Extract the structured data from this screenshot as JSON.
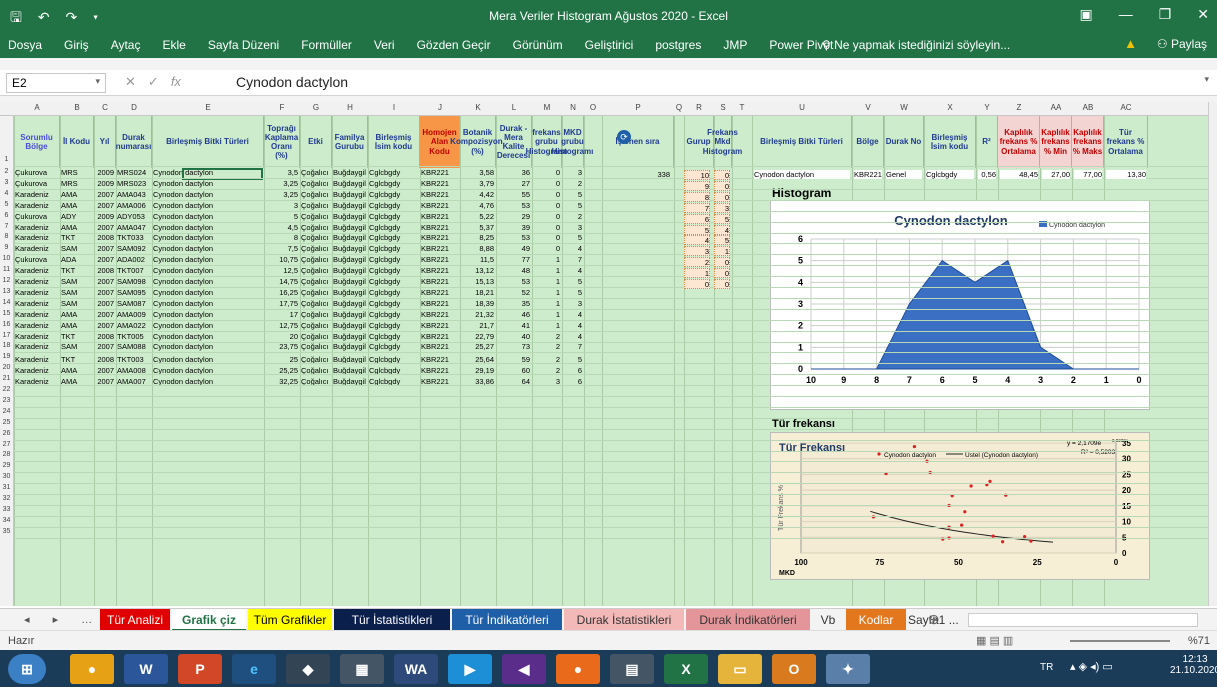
{
  "app": {
    "title": "Mera Veriler Histogram Ağustos 2020 - Excel",
    "share": "Paylaş",
    "tell": "Ne yapmak istediğinizi söyleyin..."
  },
  "ribbon_tabs": [
    "Dosya",
    "Giriş",
    "Aytaç",
    "Ekle",
    "Sayfa Düzeni",
    "Formüller",
    "Veri",
    "Gözden Geçir",
    "Görünüm",
    "Geliştirici",
    "postgres",
    "JMP",
    "Power Pivot"
  ],
  "formula": {
    "cell": "E2",
    "value": "Cynodon dactylon"
  },
  "columns": [
    "A",
    "B",
    "C",
    "D",
    "E",
    "F",
    "G",
    "H",
    "I",
    "J",
    "K",
    "L",
    "M",
    "N",
    "O",
    "P",
    "Q",
    "R",
    "S",
    "T",
    "U",
    "V",
    "W",
    "X",
    "Y",
    "Z",
    "AA",
    "AB",
    "AC"
  ],
  "headers": {
    "a": "Sorumlu Bölge",
    "b": "İl Kodu",
    "c": "Yıl",
    "d": "Durak numarası",
    "e": "Birleşmiş Bitki Türleri",
    "f": "Toprağı Kaplama Oranı (%)",
    "g": "Etki",
    "h": "Familya Gurubu",
    "i": "Birleşmiş İsim kodu",
    "j": "Homojen Alan Kodu",
    "k": "Botanik Kompozisyon, (%)",
    "l": "Durak - Mera Kalite Derecesi",
    "m": "frekans grubu Histogramı",
    "n": "MKD grubu Histogramı",
    "p": "İşlenen sıra",
    "r": "Gurup",
    "s": "Frekans Mkd Histogram",
    "u": "Birleşmiş Bitki Türleri",
    "v": "Bölge",
    "w": "Durak No",
    "x": "Birleşmiş İsim kodu",
    "y": "R²",
    "z": "Kaplılık frekans % Ortalama",
    "aa": "Kaplılık frekans % Min",
    "ab": "Kaplılık frekans % Maks",
    "ac": "Tür frekans % Ortalama"
  },
  "rows": [
    [
      "Çukurova",
      "MRS",
      "2009",
      "MRS024",
      "Cynodon dactylon",
      "3,5",
      "Çoğalıcı",
      "Buğdaygil",
      "Cglcbgdy",
      "KBR221",
      "3,58",
      "36",
      "0",
      "3"
    ],
    [
      "Çukurova",
      "MRS",
      "2009",
      "MRS023",
      "Cynodon dactylon",
      "3,25",
      "Çoğalıcı",
      "Buğdaygil",
      "Cglcbgdy",
      "KBR221",
      "3,79",
      "27",
      "0",
      "2"
    ],
    [
      "Karadeniz",
      "AMA",
      "2007",
      "AMA043",
      "Cynodon dactylon",
      "3,25",
      "Çoğalıcı",
      "Buğdaygil",
      "Cglcbgdy",
      "KBR221",
      "4,42",
      "55",
      "0",
      "5"
    ],
    [
      "Karadeniz",
      "AMA",
      "2007",
      "AMA006",
      "Cynodon dactylon",
      "3",
      "Çoğalıcı",
      "Buğdaygil",
      "Cglcbgdy",
      "KBR221",
      "4,76",
      "53",
      "0",
      "5"
    ],
    [
      "Çukurova",
      "ADY",
      "2009",
      "ADY053",
      "Cynodon dactylon",
      "5",
      "Çoğalıcı",
      "Buğdaygil",
      "Cglcbgdy",
      "KBR221",
      "5,22",
      "29",
      "0",
      "2"
    ],
    [
      "Karadeniz",
      "AMA",
      "2007",
      "AMA047",
      "Cynodon dactylon",
      "4,5",
      "Çoğalıcı",
      "Buğdaygil",
      "Cglcbgdy",
      "KBR221",
      "5,37",
      "39",
      "0",
      "3"
    ],
    [
      "Karadeniz",
      "TKT",
      "2008",
      "TKT033",
      "Cynodon dactylon",
      "8",
      "Çoğalıcı",
      "Buğdaygil",
      "Cglcbgdy",
      "KBR221",
      "8,25",
      "53",
      "0",
      "5"
    ],
    [
      "Karadeniz",
      "SAM",
      "2007",
      "SAM092",
      "Cynodon dactylon",
      "7,5",
      "Çoğalıcı",
      "Buğdaygil",
      "Cglcbgdy",
      "KBR221",
      "8,88",
      "49",
      "0",
      "4"
    ],
    [
      "Çukurova",
      "ADA",
      "2007",
      "ADA002",
      "Cynodon dactylon",
      "10,75",
      "Çoğalıcı",
      "Buğdaygil",
      "Cglcbgdy",
      "KBR221",
      "11,5",
      "77",
      "1",
      "7"
    ],
    [
      "Karadeniz",
      "TKT",
      "2008",
      "TKT007",
      "Cynodon dactylon",
      "12,5",
      "Çoğalıcı",
      "Buğdaygil",
      "Cglcbgdy",
      "KBR221",
      "13,12",
      "48",
      "1",
      "4"
    ],
    [
      "Karadeniz",
      "SAM",
      "2007",
      "SAM098",
      "Cynodon dactylon",
      "14,75",
      "Çoğalıcı",
      "Buğdaygil",
      "Cglcbgdy",
      "KBR221",
      "15,13",
      "53",
      "1",
      "5"
    ],
    [
      "Karadeniz",
      "SAM",
      "2007",
      "SAM095",
      "Cynodon dactylon",
      "16,25",
      "Çoğalıcı",
      "Buğdaygil",
      "Cglcbgdy",
      "KBR221",
      "18,21",
      "52",
      "1",
      "5"
    ],
    [
      "Karadeniz",
      "SAM",
      "2007",
      "SAM087",
      "Cynodon dactylon",
      "17,75",
      "Çoğalıcı",
      "Buğdaygil",
      "Cglcbgdy",
      "KBR221",
      "18,39",
      "35",
      "1",
      "3"
    ],
    [
      "Karadeniz",
      "AMA",
      "2007",
      "AMA009",
      "Cynodon dactylon",
      "17",
      "Çoğalıcı",
      "Buğdaygil",
      "Cglcbgdy",
      "KBR221",
      "21,32",
      "46",
      "1",
      "4"
    ],
    [
      "Karadeniz",
      "AMA",
      "2007",
      "AMA022",
      "Cynodon dactylon",
      "12,75",
      "Çoğalıcı",
      "Buğdaygil",
      "Cglcbgdy",
      "KBR221",
      "21,7",
      "41",
      "1",
      "4"
    ],
    [
      "Karadeniz",
      "TKT",
      "2008",
      "TKT005",
      "Cynodon dactylon",
      "20",
      "Çoğalıcı",
      "Buğdaygil",
      "Cglcbgdy",
      "KBR221",
      "22,79",
      "40",
      "2",
      "4"
    ],
    [
      "Karadeniz",
      "SAM",
      "2007",
      "SAM088",
      "Cynodon dactylon",
      "23,75",
      "Çoğalıcı",
      "Buğdaygil",
      "Cglcbgdy",
      "KBR221",
      "25,27",
      "73",
      "2",
      "7"
    ],
    [
      "Karadeniz",
      "TKT",
      "2008",
      "TKT003",
      "Cynodon dactylon",
      "25",
      "Çoğalıcı",
      "Buğdaygil",
      "Cglcbgdy",
      "KBR221",
      "25,64",
      "59",
      "2",
      "5"
    ],
    [
      "Karadeniz",
      "AMA",
      "2007",
      "AMA008",
      "Cynodon dactylon",
      "25,25",
      "Çoğalıcı",
      "Buğdaygil",
      "Cglcbgdy",
      "KBR221",
      "29,19",
      "60",
      "2",
      "6"
    ],
    [
      "Karadeniz",
      "AMA",
      "2007",
      "AMA007",
      "Cynodon dactylon",
      "32,25",
      "Çoğalıcı",
      "Buğdaygil",
      "Cglcbgdy",
      "KBR221",
      "33,86",
      "64",
      "3",
      "6"
    ]
  ],
  "row_numbers": [
    "1",
    "2",
    "3",
    "4",
    "5",
    "6",
    "7",
    "8",
    "9",
    "10",
    "11",
    "12",
    "13",
    "14",
    "15",
    "16",
    "17",
    "18",
    "19",
    "20",
    "21",
    "22",
    "23",
    "24",
    "25",
    "26",
    "27",
    "28",
    "29",
    "30",
    "31",
    "32",
    "33",
    "34",
    "35"
  ],
  "p2": "338",
  "gurup_table": [
    [
      "10",
      "0"
    ],
    [
      "9",
      "0"
    ],
    [
      "8",
      "0"
    ],
    [
      "7",
      "3"
    ],
    [
      "6",
      "5"
    ],
    [
      "5",
      "4"
    ],
    [
      "4",
      "5"
    ],
    [
      "3",
      "1"
    ],
    [
      "2",
      "0"
    ],
    [
      "1",
      "0"
    ],
    [
      "0",
      "0"
    ]
  ],
  "summary_row": {
    "u": "Cynodon dactylon",
    "v": "KBR221",
    "w": "Genel",
    "x": "Cglcbgdy",
    "y": "0,56",
    "z": "48,45",
    "aa": "27,00",
    "ab": "77,00",
    "ac": "13,30"
  },
  "histogram_label": "Histogram",
  "tur_frekansi_label": "Tür frekansı",
  "chart_data": [
    {
      "type": "area",
      "title": "Cynodon dactylon",
      "series": [
        {
          "name": "Cynodon dactylon",
          "values": [
            0,
            0,
            0,
            3,
            5,
            4,
            5,
            1,
            0,
            0,
            0
          ]
        }
      ],
      "categories": [
        "10",
        "9",
        "8",
        "7",
        "6",
        "5",
        "4",
        "3",
        "2",
        "1",
        "0"
      ],
      "ylim": [
        0,
        6
      ],
      "legend": "top-right"
    },
    {
      "type": "scatter",
      "title": "Tür Frekansı",
      "ylabel": "Tür Frekans %",
      "xlabel": "MKD",
      "equation": "y = 2,1709e",
      "eq_exp": "0,0232x",
      "r2": "R² = 0,5203",
      "xlim": [
        100,
        0
      ],
      "ylim": [
        0,
        35
      ],
      "x_ticks": [
        "100",
        "75",
        "50",
        "25",
        "0"
      ],
      "y_ticks": [
        "0",
        "5",
        "10",
        "15",
        "20",
        "25",
        "30",
        "35"
      ],
      "legend": [
        "Cynodon dactylon",
        "Üstel (Cynodon dactylon)"
      ],
      "points": [
        [
          36,
          3.58
        ],
        [
          27,
          3.79
        ],
        [
          55,
          4.42
        ],
        [
          53,
          4.76
        ],
        [
          29,
          5.22
        ],
        [
          39,
          5.37
        ],
        [
          53,
          8.25
        ],
        [
          49,
          8.88
        ],
        [
          77,
          11.5
        ],
        [
          48,
          13.12
        ],
        [
          53,
          15.13
        ],
        [
          52,
          18.21
        ],
        [
          35,
          18.39
        ],
        [
          46,
          21.32
        ],
        [
          41,
          21.7
        ],
        [
          40,
          22.79
        ],
        [
          73,
          25.27
        ],
        [
          59,
          25.64
        ],
        [
          60,
          29.19
        ],
        [
          64,
          33.86
        ]
      ]
    }
  ],
  "sheets": [
    {
      "name": "Tür Analizi",
      "bg": "#e00000",
      "fg": "#fff"
    },
    {
      "name": "Grafik çiz",
      "bg": "#ffffff",
      "fg": "#217346",
      "active": true
    },
    {
      "name": "Tüm Grafikler",
      "bg": "#ffff00",
      "fg": "#000"
    },
    {
      "name": "Tür İstatistikleri",
      "bg": "#0b1f4d",
      "fg": "#fff"
    },
    {
      "name": "Tür İndikatörleri",
      "bg": "#1f5fa8",
      "fg": "#fff"
    },
    {
      "name": "Durak İstatistikleri",
      "bg": "#f3b8b8",
      "fg": "#333"
    },
    {
      "name": "Durak İndikatörleri",
      "bg": "#e3959a",
      "fg": "#333"
    },
    {
      "name": "Vb",
      "bg": "#f3f3f3",
      "fg": "#333"
    },
    {
      "name": "Kodlar",
      "bg": "#e3771e",
      "fg": "#fff"
    },
    {
      "name": "Sayfa1 ...",
      "bg": "#f3f3f3",
      "fg": "#333"
    }
  ],
  "status": {
    "ready": "Hazır",
    "zoom": "%71"
  },
  "taskbar": {
    "lang": "TR",
    "time": "12:13",
    "date": "21.10.2020"
  }
}
